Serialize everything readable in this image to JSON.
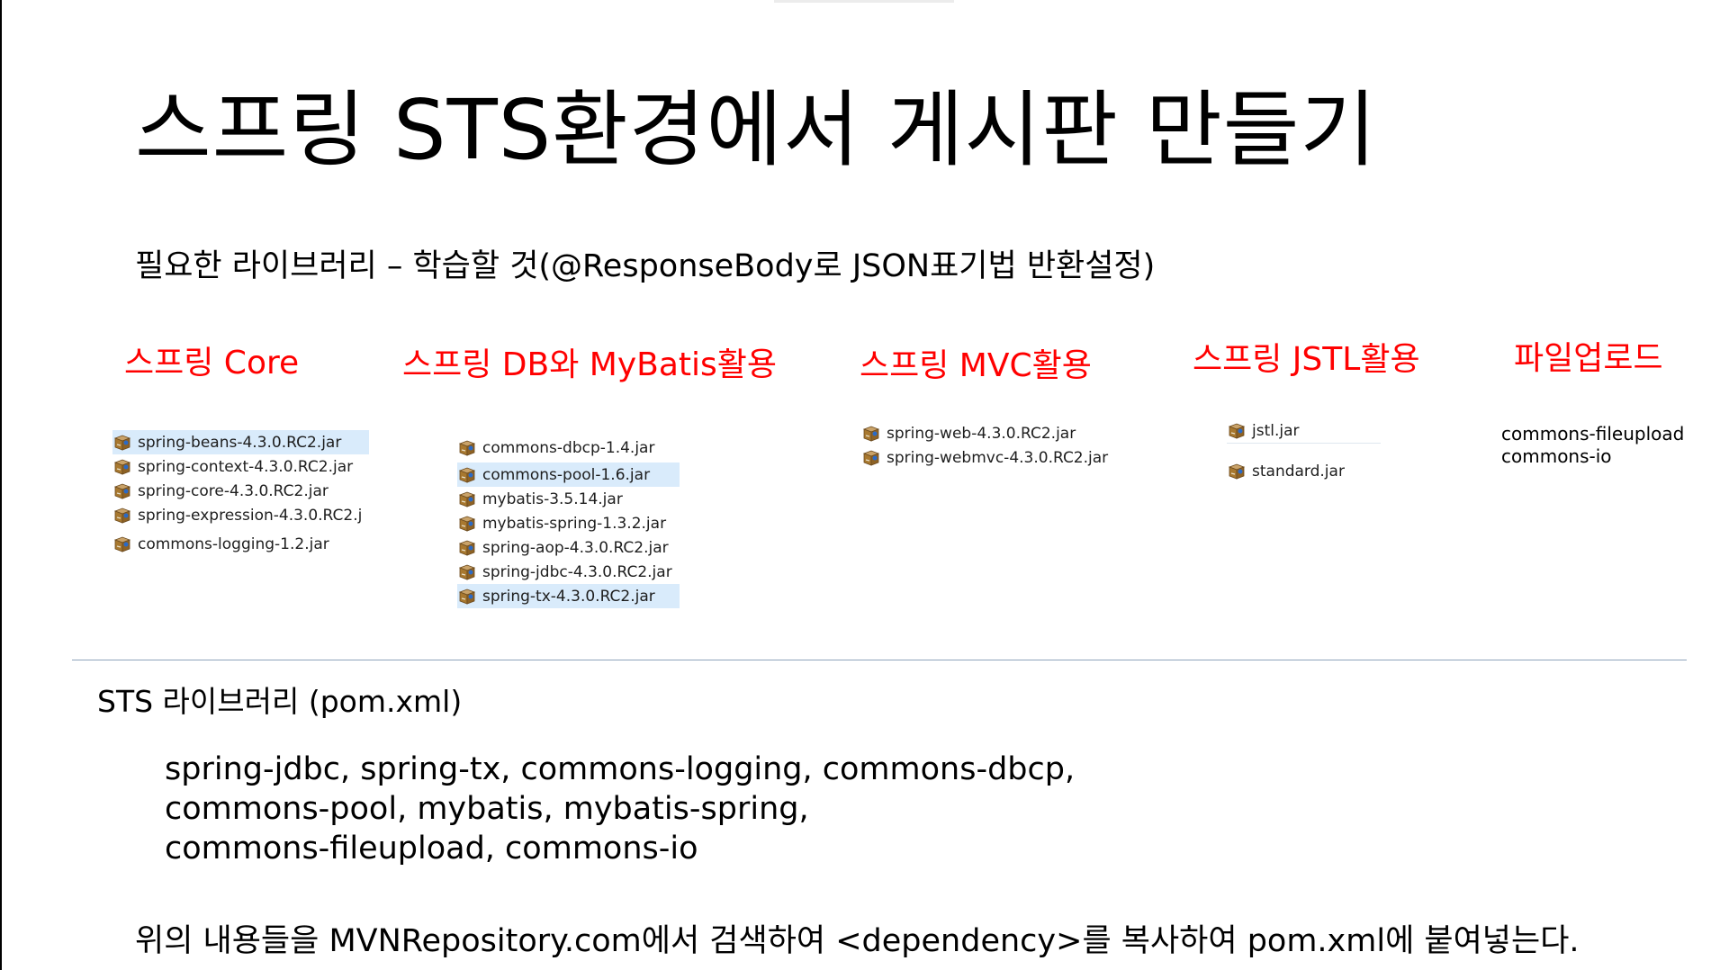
{
  "slide": {
    "title": "스프링 STS환경에서 게시판 만들기",
    "subtitle": "필요한 라이브러리 – 학습할 것(@ResponseBody로 JSON표기법 반환설정)"
  },
  "categories": [
    {
      "label": "스프링 Core",
      "jars": [
        "spring-beans-4.3.0.RC2.jar",
        "spring-context-4.3.0.RC2.jar",
        "spring-core-4.3.0.RC2.jar",
        "spring-expression-4.3.0.RC2.j",
        "commons-logging-1.2.jar"
      ]
    },
    {
      "label": "스프링 DB와 MyBatis활용",
      "jars": [
        "commons-dbcp-1.4.jar",
        "commons-pool-1.6.jar",
        "mybatis-3.5.14.jar",
        "mybatis-spring-1.3.2.jar",
        "spring-aop-4.3.0.RC2.jar",
        "spring-jdbc-4.3.0.RC2.jar",
        "spring-tx-4.3.0.RC2.jar"
      ]
    },
    {
      "label": "스프링 MVC활용",
      "jars": [
        "spring-web-4.3.0.RC2.jar",
        "spring-webmvc-4.3.0.RC2.jar"
      ]
    },
    {
      "label": "스프링 JSTL활용",
      "jars": [
        "jstl.jar",
        "standard.jar"
      ]
    },
    {
      "label": "파일업로드",
      "libs": [
        "commons-fileupload",
        "commons-io"
      ]
    }
  ],
  "sts": {
    "label": "STS 라이브러리 (pom.xml)",
    "lines": [
      "spring-jdbc, spring-tx, commons-logging, commons-dbcp,",
      "commons-pool, mybatis, mybatis-spring,",
      "commons-fileupload, commons-io"
    ]
  },
  "footer": "위의 내용들을 MVNRepository.com에서 검색하여 <dependency>를 복사하여 pom.xml에 붙여넣는다.",
  "colors": {
    "category": "#ff0000",
    "divider": "#8ea4bc",
    "selection": "#d9ebfb"
  },
  "icons": {
    "jar": "jar-file-icon"
  }
}
